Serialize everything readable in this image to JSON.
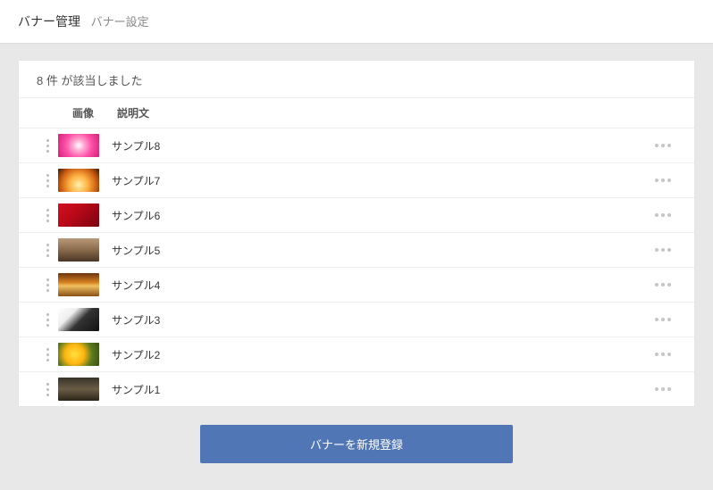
{
  "header": {
    "title": "バナー管理",
    "subtitle": "バナー設定"
  },
  "count_text": "8 件 が該当しました",
  "columns": {
    "image": "画像",
    "description": "説明文"
  },
  "rows": [
    {
      "label": "サンプル8",
      "thumb_class": "t8"
    },
    {
      "label": "サンプル7",
      "thumb_class": "t7"
    },
    {
      "label": "サンプル6",
      "thumb_class": "t6"
    },
    {
      "label": "サンプル5",
      "thumb_class": "t5"
    },
    {
      "label": "サンプル4",
      "thumb_class": "t4"
    },
    {
      "label": "サンプル3",
      "thumb_class": "t3"
    },
    {
      "label": "サンプル2",
      "thumb_class": "t2"
    },
    {
      "label": "サンプル1",
      "thumb_class": "t1"
    }
  ],
  "button": {
    "create": "バナーを新規登録"
  }
}
